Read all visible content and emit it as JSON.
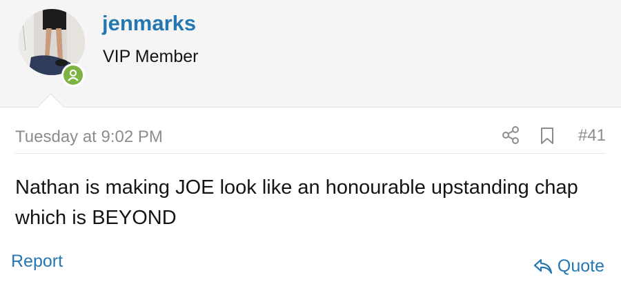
{
  "user": {
    "username": "jenmarks",
    "title": "VIP Member",
    "status": "online"
  },
  "post": {
    "date": "Tuesday at 9:02 PM",
    "number": "#41",
    "message": "Nathan is making JOE look like an honourable upstanding chap which is BEYOND"
  },
  "actions": {
    "report_label": "Report",
    "quote_label": "Quote"
  },
  "icons": {
    "share": "share-icon",
    "bookmark": "bookmark-icon",
    "quote": "reply-arrow-icon",
    "online": "online-status-icon"
  },
  "colors": {
    "link": "#2577b1",
    "online": "#7cb342",
    "muted": "#8c8c8c",
    "header_bg": "#f5f5f5"
  }
}
